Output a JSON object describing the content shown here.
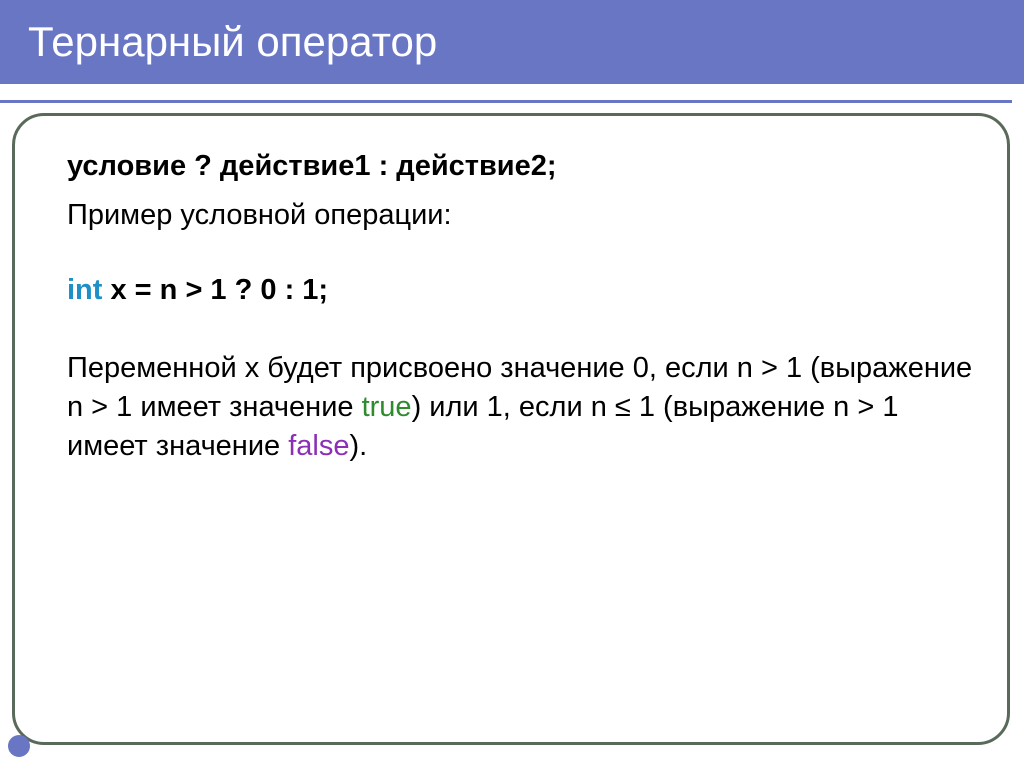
{
  "slide": {
    "title": "Тернарный оператор",
    "syntax": "условие ? действие1 : действие2;",
    "example_label": "Пример условной операции:",
    "code": {
      "keyword": "int",
      "rest": " x = n > 1 ? 0 : 1;"
    },
    "explanation": {
      "part1": "Переменной x будет присвоено значение 0, если n > 1 (выражение n > 1 имеет значение ",
      "true_word": "true",
      "part2": ") или 1, если n ≤ 1 (выражение n > 1 имеет значение ",
      "false_word": "false",
      "part3": ")."
    }
  }
}
